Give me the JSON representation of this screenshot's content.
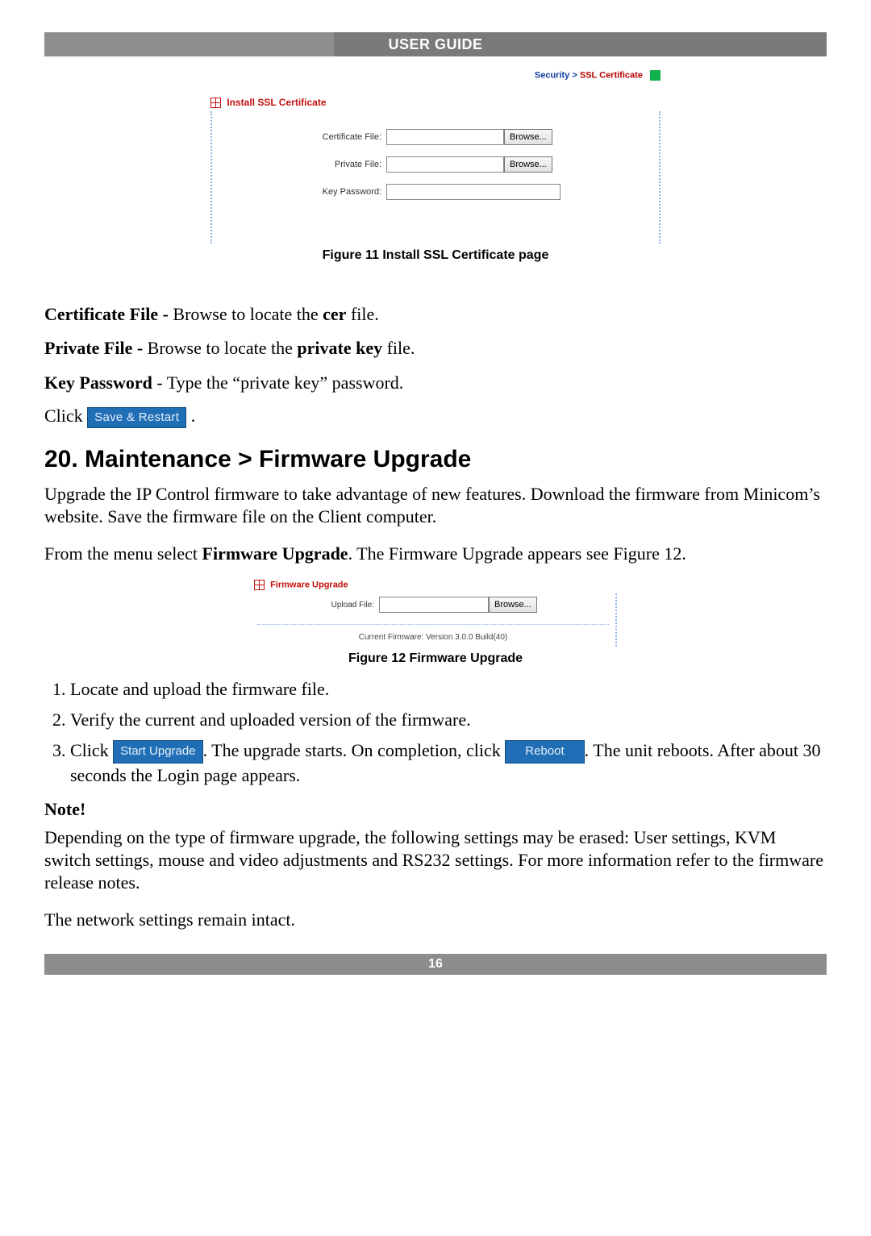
{
  "header": {
    "title": "USER GUIDE"
  },
  "footer": {
    "page_number": "16"
  },
  "ssl_panel": {
    "breadcrumb": {
      "parent": "Security",
      "sep": ">",
      "leaf": "SSL Certificate"
    },
    "title": "Install SSL Certificate",
    "fields": {
      "cert_label": "Certificate File:",
      "private_label": "Private File:",
      "password_label": "Key Password:"
    },
    "browse_label": "Browse...",
    "caption": "Figure 11 Install SSL Certificate page"
  },
  "definitions": {
    "cert": {
      "term": "Certificate File -",
      "text_before": " Browse to locate the ",
      "bold_word": "cer",
      "text_after": " file."
    },
    "private": {
      "term": "Private File -",
      "text_before": " Browse to locate the ",
      "bold_word": "private key",
      "text_after": " file."
    },
    "password": {
      "term": "Key Password",
      "text": " - Type the “private key” password."
    },
    "click_prefix": "Click ",
    "save_restart_btn": "Save & Restart",
    "click_suffix": "."
  },
  "section": {
    "heading": "20. Maintenance > Firmware Upgrade",
    "para1": "Upgrade the IP Control firmware to take advantage of new features. Download the firmware from Minicom’s website. Save the firmware file on the Client computer.",
    "para2_prefix": "From the menu select ",
    "para2_bold": "Firmware Upgrade",
    "para2_suffix": ". The Firmware Upgrade appears see Figure 12."
  },
  "fw_panel": {
    "title": "Firmware Upgrade",
    "upload_label": "Upload File:",
    "browse_label": "Browse...",
    "current": "Current Firmware: Version 3.0.0 Build(40)",
    "caption": "Figure 12 Firmware Upgrade"
  },
  "steps": {
    "s1": "Locate and upload the firmware file.",
    "s2": "Verify the current and uploaded version of the firmware.",
    "s3_prefix": "Click ",
    "s3_btn1": "Start Upgrade",
    "s3_mid": ". The upgrade starts. On completion, click ",
    "s3_btn2": "Reboot",
    "s3_tail": ". The unit reboots. After about 30 seconds the Login page appears."
  },
  "note": {
    "heading": "Note!",
    "body": "Depending on the type of firmware upgrade, the following settings may be erased: User settings, KVM switch settings, mouse and video adjustments and RS232 settings. For more information refer to the firmware release notes.",
    "tail": "The network settings remain intact."
  }
}
